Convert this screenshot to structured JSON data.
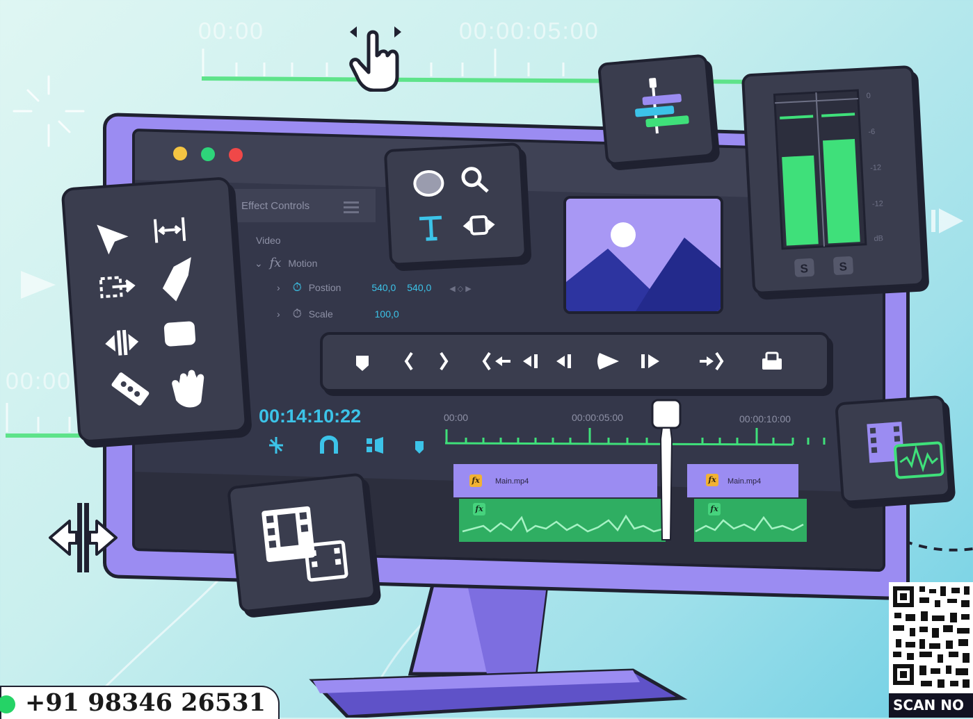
{
  "background_timecodes": [
    "00:00",
    "00:00:05:00",
    "00:00"
  ],
  "effect_controls": {
    "title": "Effect Controls",
    "section": "Video",
    "group": "Motion",
    "rows": [
      {
        "label": "Postion",
        "v1": "540,0",
        "v2": "540,0"
      },
      {
        "label": "Scale",
        "v1": "100,0"
      }
    ]
  },
  "timeline": {
    "current_time": "00:14:10:22",
    "ruler_labels": [
      "00:00",
      "00:00:05:00",
      "00:00:10:00"
    ],
    "clips": [
      {
        "name": "Main.mp4",
        "fx": "fx"
      },
      {
        "name": "Main.mp4",
        "fx": "fx"
      }
    ]
  },
  "audio_meter": {
    "scale": [
      "0",
      "-6",
      "-12",
      "-12",
      "dB"
    ],
    "solo_buttons": [
      "S",
      "S"
    ],
    "levels": [
      0.62,
      0.72
    ]
  },
  "window_controls": {
    "colors": [
      "#f5c542",
      "#2ed47a",
      "#f04848"
    ]
  },
  "contact": {
    "phone": "+91 98346 26531"
  },
  "qr": {
    "caption": "SCAN NO"
  },
  "tools": [
    "selection-arrow-icon",
    "track-select-icon",
    "ripple-edit-icon",
    "pen-icon",
    "slip-icon",
    "rectangle-icon",
    "razor-icon",
    "hand-icon",
    "ellipse-icon",
    "zoom-icon",
    "type-icon",
    "rate-stretch-icon"
  ],
  "colors": {
    "accent_green": "#3fe07a",
    "accent_purple": "#9b8cf2",
    "accent_blue": "#3cc3e8",
    "panel": "#3a3d4e"
  }
}
